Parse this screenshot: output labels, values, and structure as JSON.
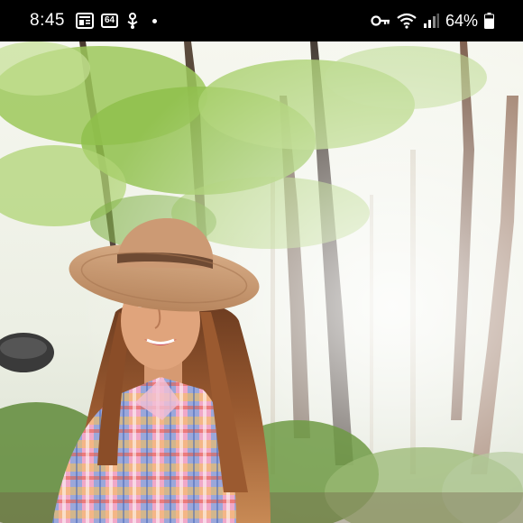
{
  "status_bar": {
    "time": "8:45",
    "notif_badge_2": "64",
    "battery_percent": "64%",
    "icons": [
      "news-icon",
      "badge-64-icon",
      "usb-icon",
      "more-dot-icon",
      "vpn-key-icon",
      "wifi-icon",
      "signal-icon",
      "battery-icon"
    ]
  },
  "photo": {
    "subject": "photo-outdoor-portrait"
  },
  "colors": {
    "status_bar_bg": "#000000",
    "status_icon": "#ffffff"
  }
}
